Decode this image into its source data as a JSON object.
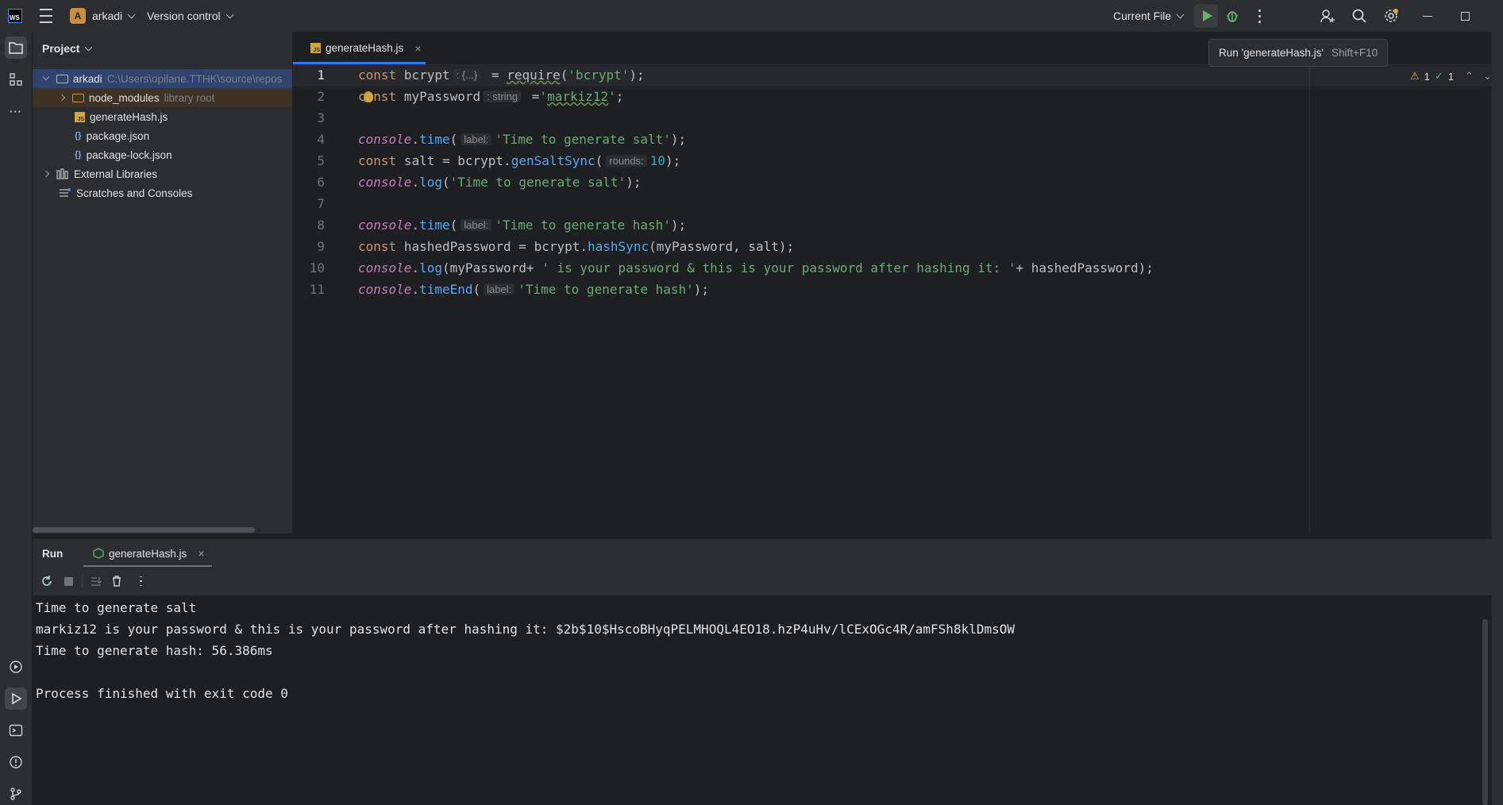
{
  "titlebar": {
    "project_badge": "A",
    "project_name": "arkadi",
    "vcs_label": "Version control",
    "run_config": "Current File",
    "icons": [
      "webstorm-logo",
      "hamburger-menu-icon",
      "run-icon",
      "debug-icon",
      "more-icon",
      "add-user-icon",
      "search-icon",
      "settings-icon",
      "minimize-icon",
      "restore-icon",
      "close-icon"
    ]
  },
  "tooltip": {
    "text": "Run 'generateHash.js'",
    "shortcut": "Shift+F10"
  },
  "project_panel": {
    "title": "Project",
    "tree": [
      {
        "label": "arkadi",
        "hint": "C:\\Users\\opilane.TTHK\\source\\repos",
        "type": "folder",
        "expanded": true
      },
      {
        "label": "node_modules",
        "hint": "library root",
        "type": "folder-lib",
        "expanded": false
      },
      {
        "label": "generateHash.js",
        "type": "js"
      },
      {
        "label": "package.json",
        "type": "json"
      },
      {
        "label": "package-lock.json",
        "type": "json"
      },
      {
        "label": "External Libraries",
        "type": "libraries"
      },
      {
        "label": "Scratches and Consoles",
        "type": "scratches"
      }
    ]
  },
  "editor": {
    "tab_label": "generateHash.js",
    "tab_badge": "JS",
    "inspection": {
      "warnings": "1",
      "ok": "1"
    },
    "line_numbers": [
      "1",
      "2",
      "3",
      "4",
      "5",
      "6",
      "7",
      "8",
      "9",
      "10",
      "11"
    ],
    "hints": {
      "bcrypt_type": ": {...}",
      "password_type": ": string",
      "label": "label:",
      "rounds": "rounds:"
    },
    "tokens": {
      "const": "const",
      "bcrypt": "bcrypt",
      "require": "require",
      "bcrypt_str": "'bcrypt'",
      "myPassword": "myPassword",
      "markiz12": "markiz12",
      "console": "console",
      "time": "time",
      "salt_label": "'Time to generate salt'",
      "salt": "salt",
      "genSaltSync": "genSaltSync",
      "rounds_val": "10",
      "log": "log",
      "hash_label": "'Time to generate hash'",
      "hashedPassword": "hashedPassword",
      "hashSync": "hashSync",
      "long_str": "' is your password & this is your password after hashing it: '",
      "timeEnd": "timeEnd"
    }
  },
  "run_panel": {
    "title": "Run",
    "tab_label": "generateHash.js",
    "toolbar_icons": [
      "rerun-icon",
      "stop-icon",
      "scroll-to-end-icon",
      "clear-icon",
      "more-icon"
    ],
    "output": [
      "Time to generate salt",
      "markiz12 is your password & this is your password after hashing it: $2b$10$HscoBHyqPELMHOQL4EO18.hzP4uHv/lCExOGc4R/amFSh8klDmsOW",
      "Time to generate hash: 56.386ms",
      "",
      "Process finished with exit code 0"
    ]
  }
}
